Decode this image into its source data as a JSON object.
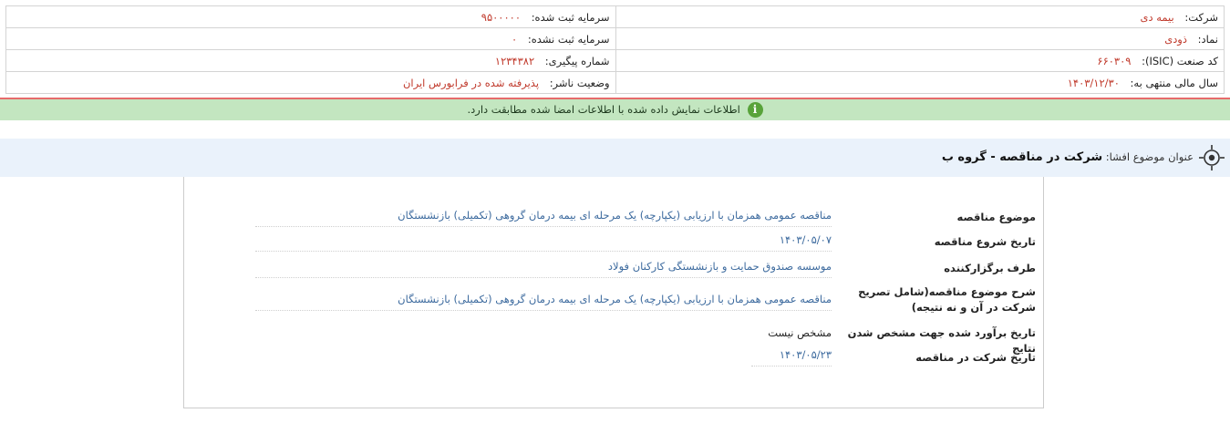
{
  "header": {
    "company_label": "شرکت:",
    "company_value": "بیمه دی",
    "capital_registered_label": "سرمایه ثبت شده:",
    "capital_registered_value": "۹۵۰۰۰۰۰",
    "symbol_label": "نماد:",
    "symbol_value": "ذودی",
    "capital_unregistered_label": "سرمایه ثبت نشده:",
    "capital_unregistered_value": "۰",
    "isic_label": "کد صنعت (ISIC):",
    "isic_value": "۶۶۰۳۰۹",
    "tracking_label": "شماره پیگیری:",
    "tracking_value": "۱۲۳۴۳۸۲",
    "fiscal_year_label": "سال مالی منتهی به:",
    "fiscal_year_value": "۱۴۰۳/۱۲/۳۰",
    "publisher_status_label": "وضعیت ناشر:",
    "publisher_status_value": "پذیرفته شده در فرابورس ایران"
  },
  "notice": {
    "icon": "info-icon",
    "text": "اطلاعات نمایش داده شده با اطلاعات امضا شده مطابقت دارد."
  },
  "title": {
    "icon": "target-icon",
    "label": "عنوان موضوع افشا:",
    "value": "شرکت در مناقصه - گروه ب"
  },
  "details": {
    "tender_subject_label": "موضوع مناقصه",
    "tender_subject_value": "مناقصه عمومی همزمان با ارزیابی (یکپارچه) یک مرحله ای بیمه درمان گروهی (تکمیلی) بازنشستگان",
    "tender_start_label": "تاریخ شروع مناقصه",
    "tender_start_value": "۱۴۰۳/۰۵/۰۷",
    "organizer_label": "طرف برگزارکننده",
    "organizer_value": "موسسه صندوق حمایت و بازنشستگی کارکنان فولاد",
    "description_label": "شرح موضوع مناقصه(شامل تصریح شرکت در آن و نه نتیجه)",
    "description_value": "مناقصه عمومی همزمان با ارزیابی (یکپارچه) یک مرحله ای بیمه درمان گروهی (تکمیلی) بازنشستگان",
    "results_date_label": "تاریخ برآورد شده جهت مشخص شدن نتایج",
    "results_date_value": "مشخص نیست",
    "participation_date_label": "تاریخ شرکت در مناقصه",
    "participation_date_value": "۱۴۰۳/۰۵/۲۳"
  },
  "colors": {
    "value_red": "#c0392b",
    "value_blue": "#3c6a9e",
    "notice_bg": "#c3e6c0",
    "title_bg": "#eaf2fb"
  }
}
